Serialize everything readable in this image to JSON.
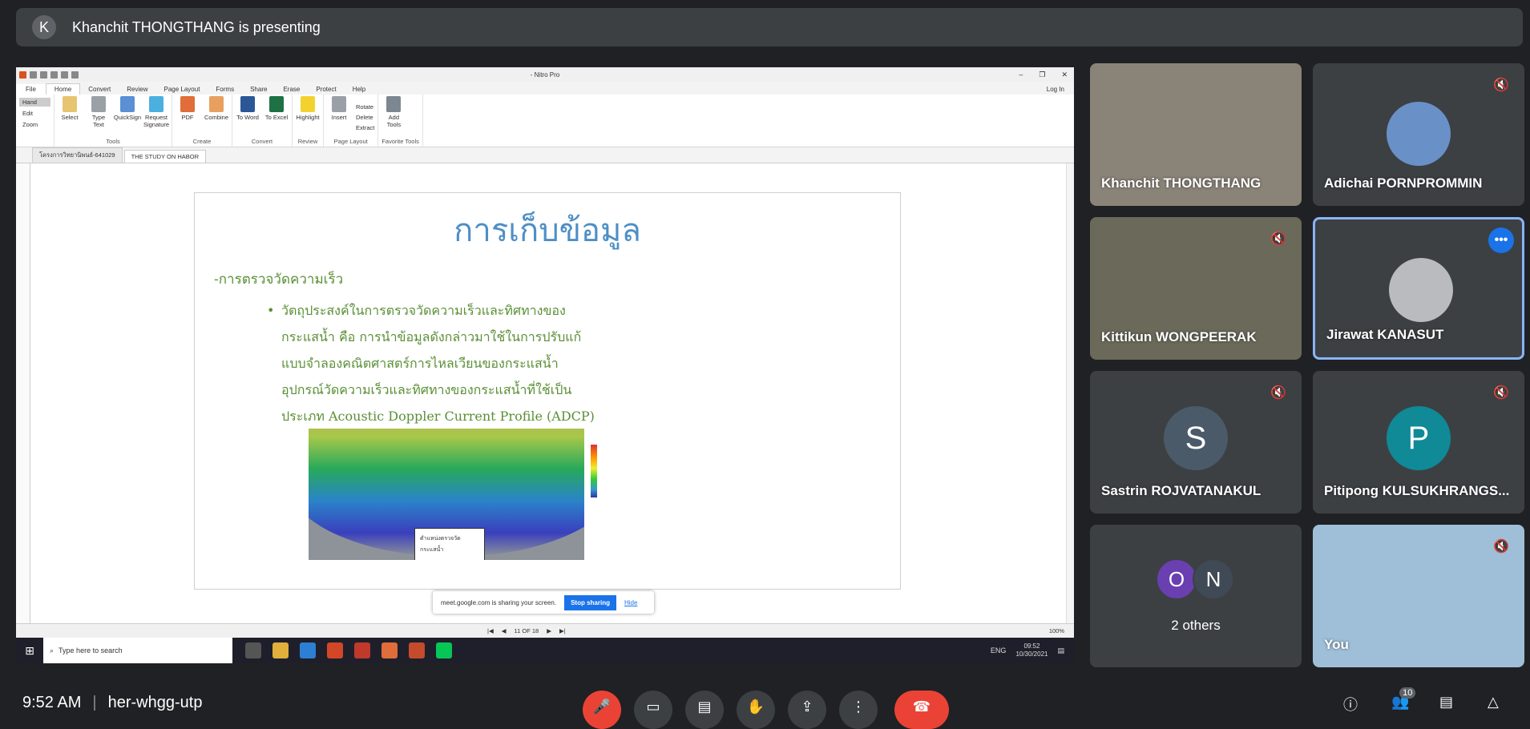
{
  "banner": {
    "avatar_letter": "K",
    "text": "Khanchit THONGTHANG is presenting"
  },
  "nitro": {
    "app_title": "- Nitro Pro",
    "menu": [
      "Home",
      "Convert",
      "Review",
      "Page Layout",
      "Forms",
      "Share",
      "Erase",
      "Protect",
      "Help"
    ],
    "file": "File",
    "login": "Log In",
    "modes": [
      "Hand",
      "Edit",
      "Zoom"
    ],
    "groups": [
      {
        "name": "Tools",
        "tools": [
          "Select",
          "Type Text",
          "QuickSign",
          "Request Signature"
        ]
      },
      {
        "name": "Create",
        "tools": [
          "PDF",
          "Combine"
        ]
      },
      {
        "name": "Convert",
        "tools": [
          "To Word",
          "To Excel"
        ]
      },
      {
        "name": "Review",
        "tools": [
          "Highlight"
        ]
      },
      {
        "name": "Page Layout",
        "tools": [
          "Insert"
        ],
        "small": [
          "Rotate",
          "Delete",
          "Extract"
        ]
      },
      {
        "name": "Favorite Tools",
        "tools": [
          "Add Tools"
        ]
      }
    ],
    "tabs": [
      "โครงการวิทยานิพนธ์-641029",
      "THE STUDY ON HABOR"
    ],
    "slide": {
      "title": "การเก็บข้อมูล",
      "subtitle": "-การตรวจวัดความเร็ว",
      "bullet": "•",
      "lines": [
        "วัตถุประสงค์ในการตรวจวัดความเร็วและทิศทางของ",
        "กระแสน้ำ คือ การนำข้อมูลดังกล่าวมาใช้ในการปรับแก้",
        "แบบจำลองคณิตศาสตร์การไหลเวียนของกระแสน้ำ",
        "อุปกรณ์วัดความเร็วและทิศทางของกระแสน้ำที่ใช้เป็น",
        "ประเภท Acoustic Doppler Current Profile (ADCP)"
      ],
      "map_label_1": "ตำแหน่งตรวจวัด",
      "map_label_2": "กระแสน้ำ"
    },
    "share_notice": {
      "text": "meet.google.com is sharing your screen.",
      "stop": "Stop sharing",
      "hide": "Hide"
    },
    "page_indicator": "11 OF 18",
    "zoom": "100%",
    "taskbar": {
      "search": "Type here to search",
      "lang": "ENG",
      "time": "09:52",
      "date": "10/30/2021"
    }
  },
  "participants": [
    {
      "name": "Khanchit THONGTHANG",
      "type": "video",
      "muted": false
    },
    {
      "name": "Adichai PORNPROMMIN",
      "type": "photo",
      "muted": true
    },
    {
      "name": "Kittikun WONGPEERAK",
      "type": "video",
      "muted": true
    },
    {
      "name": "Jirawat KANASUT",
      "type": "photo",
      "muted": false
    },
    {
      "name": "Sastrin ROJVATANAKUL",
      "type": "letter",
      "letter": "S",
      "muted": true
    },
    {
      "name": "Pitipong KULSUKHRANGS...",
      "type": "letter",
      "letter": "P",
      "muted": true
    },
    {
      "name": "2 others",
      "type": "group",
      "letters": [
        "O",
        "N"
      ]
    },
    {
      "name": "You",
      "type": "video",
      "muted": true
    }
  ],
  "bottom": {
    "time": "9:52 AM",
    "meeting_code": "her-whgg-utp",
    "people_count": "10"
  },
  "colors": {
    "accent": "#1a73e8",
    "danger": "#ea4335",
    "tile_bg": "#3c4043",
    "slide_title": "#4e8fc6",
    "slide_text": "#5a8f36"
  }
}
